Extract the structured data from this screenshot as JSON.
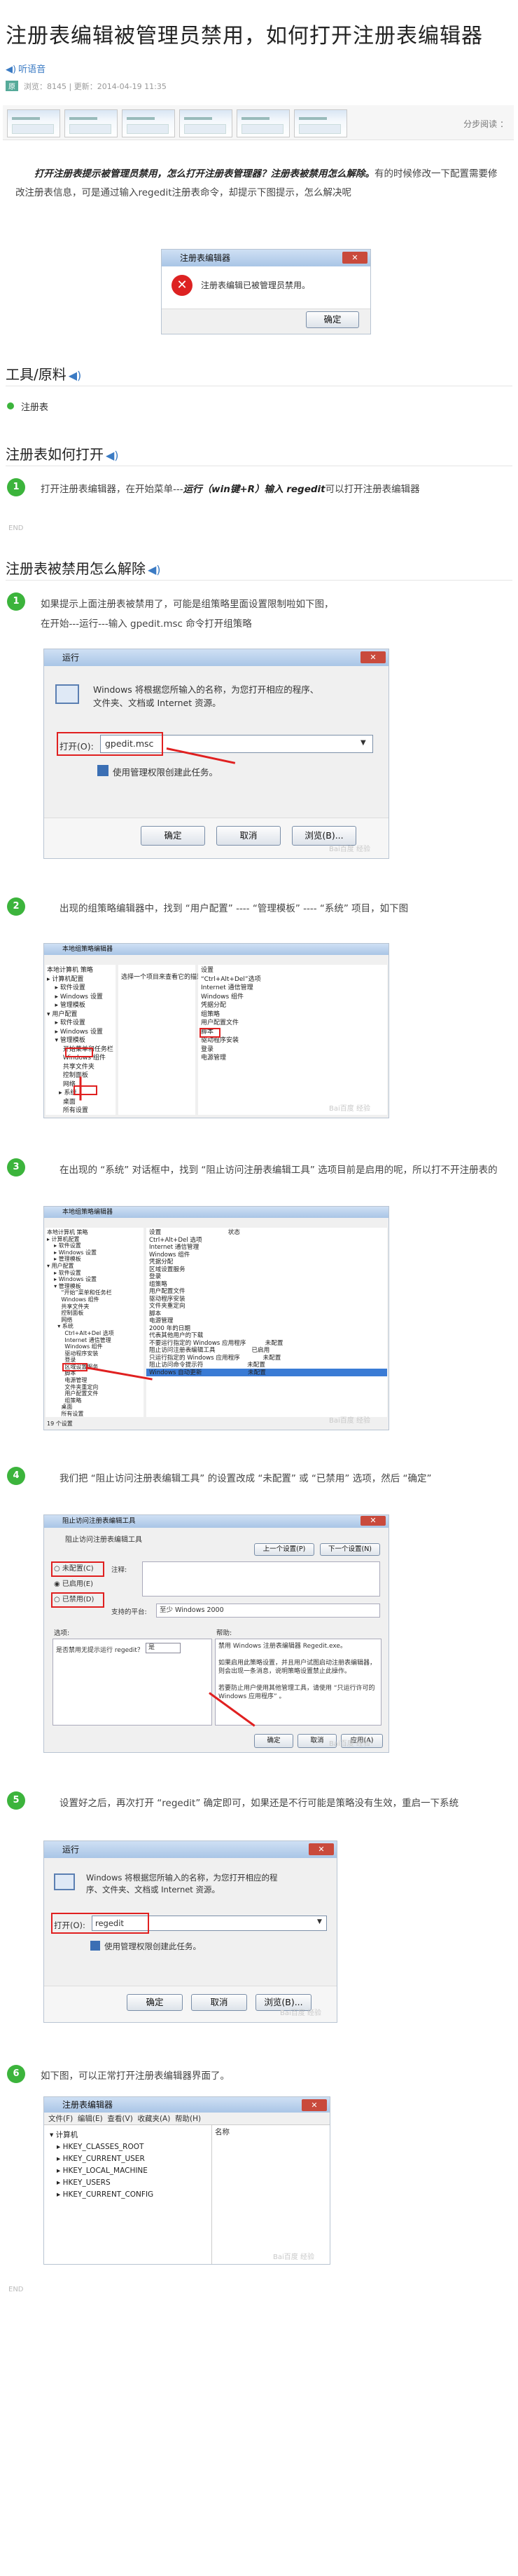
{
  "article": {
    "title": "注册表编辑被管理员禁用，如何打开注册表编辑器",
    "listen": "听语音",
    "badge": "原",
    "meta": "浏览：8145  |  更新：2014-04-19 11:35",
    "feedback": "分步阅读 ：",
    "intro_bold": "打开注册表提示被管理员禁用，怎么打开注册表管理器？注册表被禁用怎么解除。",
    "intro_rest": "有的时候修改一下配置需要修改注册表信息，可是通过输入regedit注册表命令，却提示下图提示，怎么解决呢"
  },
  "dialog_disabled": {
    "title": "注册表编辑器",
    "message": "注册表编辑已被管理员禁用。",
    "ok": "确定"
  },
  "sec_tools": {
    "title": "工具/原料",
    "item": "注册表"
  },
  "sec_open": {
    "title": "注册表如何打开",
    "step1_a": "打开注册表编辑器，在开始菜单---",
    "step1_b": "运行（win键+R）输入 regedit",
    "step1_c": "可以打开注册表编辑器"
  },
  "end_mark": "END",
  "sec_unlock": {
    "title": "注册表被禁用怎么解除",
    "s1": "如果提示上面注册表被禁用了，可能是组策略里面设置限制啦如下图，在开始---运行---输入 gpedit.msc 命令打开组策略",
    "s2": "出现的组策略编辑器中，找到 “用户配置” ---- “管理模板” ---- “系统” 项目，如下图",
    "s3": "在出现的 “系统” 对话框中，找到 “阻止访问注册表编辑工具” 选项目前是启用的呢，所以打不开注册表的",
    "s4": "我们把 “阻止访问注册表编辑工具” 的设置改成 “未配置” 或 “已禁用” 选项，然后 “确定”",
    "s5": "设置好之后，再次打开 “regedit” 确定即可，如果还是不行可能是策略没有生效，重启一下系统",
    "s6": "如下图，可以正常打开注册表编辑器界面了。"
  },
  "run1": {
    "title": "运行",
    "msg": "Windows 将根据您所输入的名称，为您打开相应的程序、文件夹、文档或 Internet 资源。",
    "label": "打开(O):",
    "value": "gpedit.msc",
    "admin": "使用管理权限创建此任务。",
    "ok": "确定",
    "cancel": "取消",
    "browse": "浏览(B)..."
  },
  "gp": {
    "title": "本地组策略编辑器",
    "tree2": "本地计算机 策略\n▸ 计算机配置\n    ▸ 软件设置\n    ▸ Windows 设置\n    ▸ 管理模板\n▾ 用户配置\n    ▸ 软件设置\n    ▸ Windows 设置\n    ▾ 管理模板\n        开始菜单和任务栏\n        Windows 组件\n        共享文件夹\n        控制面板\n        网络\n      ▸ 系统\n        桌面\n        所有设置",
    "right2": "设置\n“Ctrl+Alt+Del”选项\nInternet 通信管理\nWindows 组件\n凭据分配\n组策略\n用户配置文件\n脚本\n驱动程序安装\n登录\n电源管理",
    "hint": "选择一个项目来查看它的描述。",
    "tree3": "本地计算机 策略\n▸ 计算机配置\n    ▸ 软件设置\n    ▸ Windows 设置\n    ▸ 管理模板\n▾ 用户配置\n    ▸ 软件设置\n    ▸ Windows 设置\n    ▾ 管理模板\n        “开始”菜单和任务栏\n        Windows 组件\n        共享文件夹\n        控制面板\n        网络\n      ▾ 系统\n          Ctrl+Alt+Del 选项\n          Internet 通信管理\n          Windows 组件\n          驱动程序安装\n          登录\n          区域设置服务\n          脚本\n          电源管理\n          文件夹重定向\n          用户配置文件\n          组策略\n        桌面\n        所有设置",
    "right3": "设置                                   状态\nCtrl+Alt+Del 选项\nInternet 通信管理\nWindows 组件\n凭据分配\n区域设置服务\n登录\n组策略\n用户配置文件\n驱动程序安装\n文件夹重定向\n脚本\n电源管理\n2000 年的日期\n代表其他用户的下载\n不要运行指定的 Windows 应用程序          未配置\n阻止访问注册表编辑工具                   已启用\n只运行指定的 Windows 应用程序            未配置\n阻止访问命令提示符                       未配置\nWindows 自动更新                        未配置",
    "status": "19 个设置"
  },
  "policy": {
    "title": "阻止访问注册表编辑工具",
    "heading": "阻止访问注册表编辑工具",
    "prev": "上一个设置(P)",
    "next": "下一个设置(N)",
    "opt1": "未配置(C)",
    "opt2": "已启用(E)",
    "opt3": "已禁用(D)",
    "comment": "注释:",
    "support": "支持的平台:",
    "platform": "至少 Windows 2000",
    "options": "选项:",
    "help": "帮助:",
    "opt_line": "是否禁用无提示运行 regedit？",
    "opt_val": "是",
    "help_text": "禁用 Windows 注册表编辑器 Regedit.exe。\n\n如果启用此策略设置，并且用户试图启动注册表编辑器，则会出现一条消息，说明策略设置禁止此操作。\n\n若要防止用户使用其他管理工具，请使用 “只运行许可的 Windows 应用程序” 。",
    "ok": "确定",
    "cancel": "取消",
    "apply": "应用(A)"
  },
  "run2": {
    "title": "运行",
    "msg": "Windows 将根据您所输入的名称，为您打开相应的程序、文件夹、文档或 Internet 资源。",
    "label": "打开(O):",
    "value": "regedit",
    "admin": "使用管理权限创建此任务。",
    "ok": "确定",
    "cancel": "取消",
    "browse": "浏览(B)..."
  },
  "regedit": {
    "title": "注册表编辑器",
    "menu": "文件(F)  编辑(E)  查看(V)  收藏夹(A)  帮助(H)",
    "tree": "▾ 计算机\n   ▸ HKEY_CLASSES_ROOT\n   ▸ HKEY_CURRENT_USER\n   ▸ HKEY_LOCAL_MACHINE\n   ▸ HKEY_USERS\n   ▸ HKEY_CURRENT_CONFIG",
    "col": "名称"
  },
  "watermark": "Bai百度 经验"
}
